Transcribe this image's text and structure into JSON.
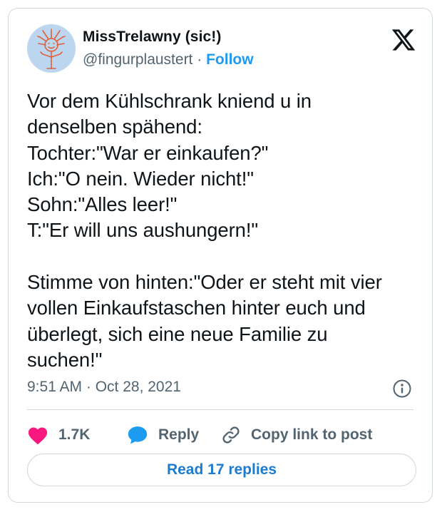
{
  "tweet": {
    "author_name": "MissTrelawny (sic!)",
    "handle": "@fingurplaustert",
    "separator": " · ",
    "follow_label": "Follow",
    "text": "Vor dem Kühlschrank kniend u in\ndenselben spähend:\nTochter:\"War er einkaufen?\"\nIch:\"O nein. Wieder nicht!\"\nSohn:\"Alles leer!\"\nT:\"Er will uns aushungern!\"\n\nStimme von hinten:\"Oder er steht mit vier\nvollen Einkaufstaschen hinter euch und\nüberlegt, sich eine neue Familie zu\nsuchen!\"",
    "timestamp": "9:51 AM · Oct 28, 2021",
    "like_count": "1.7K",
    "reply_label": "Reply",
    "copy_link_label": "Copy link to post",
    "read_replies_label": "Read 17 replies"
  },
  "icons": {
    "avatar": "avatar-doodle",
    "brand": "x-logo-icon",
    "info": "info-icon",
    "like": "heart-icon",
    "reply": "speech-bubble-icon",
    "copy_link": "link-icon"
  },
  "colors": {
    "accent": "#1d9bf0",
    "like": "#f91880",
    "muted_text": "#536471",
    "border": "#cfd9de",
    "avatar_bg": "#bcd6f0"
  }
}
